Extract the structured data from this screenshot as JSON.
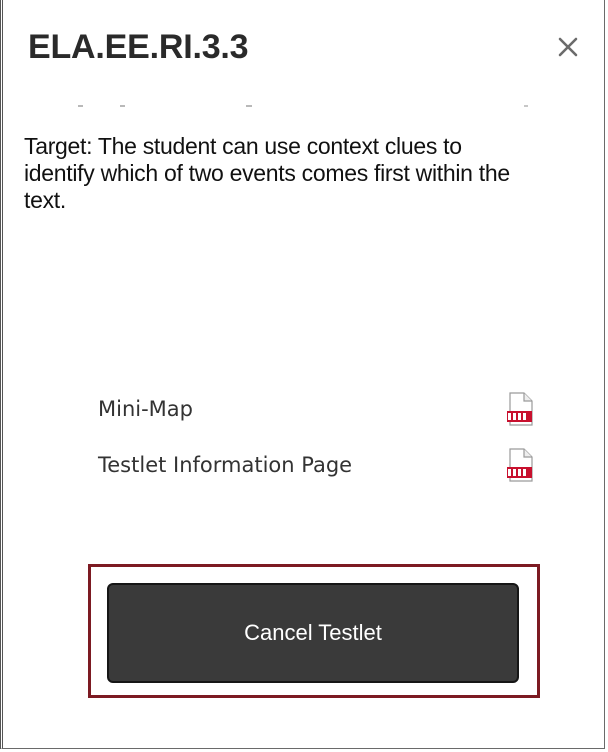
{
  "dialog": {
    "title": "ELA.EE.RI.3.3",
    "target_text": "Target: The student can use context clues to identify which of two events comes first within the text."
  },
  "documents": [
    {
      "label": "Mini-Map",
      "icon": "pdf-icon"
    },
    {
      "label": "Testlet Information Page",
      "icon": "pdf-icon"
    }
  ],
  "actions": {
    "cancel_label": "Cancel Testlet"
  },
  "colors": {
    "button_bg": "#3a3a3a",
    "highlight_border": "#7c1a22",
    "pdf_red": "#c8102e"
  }
}
